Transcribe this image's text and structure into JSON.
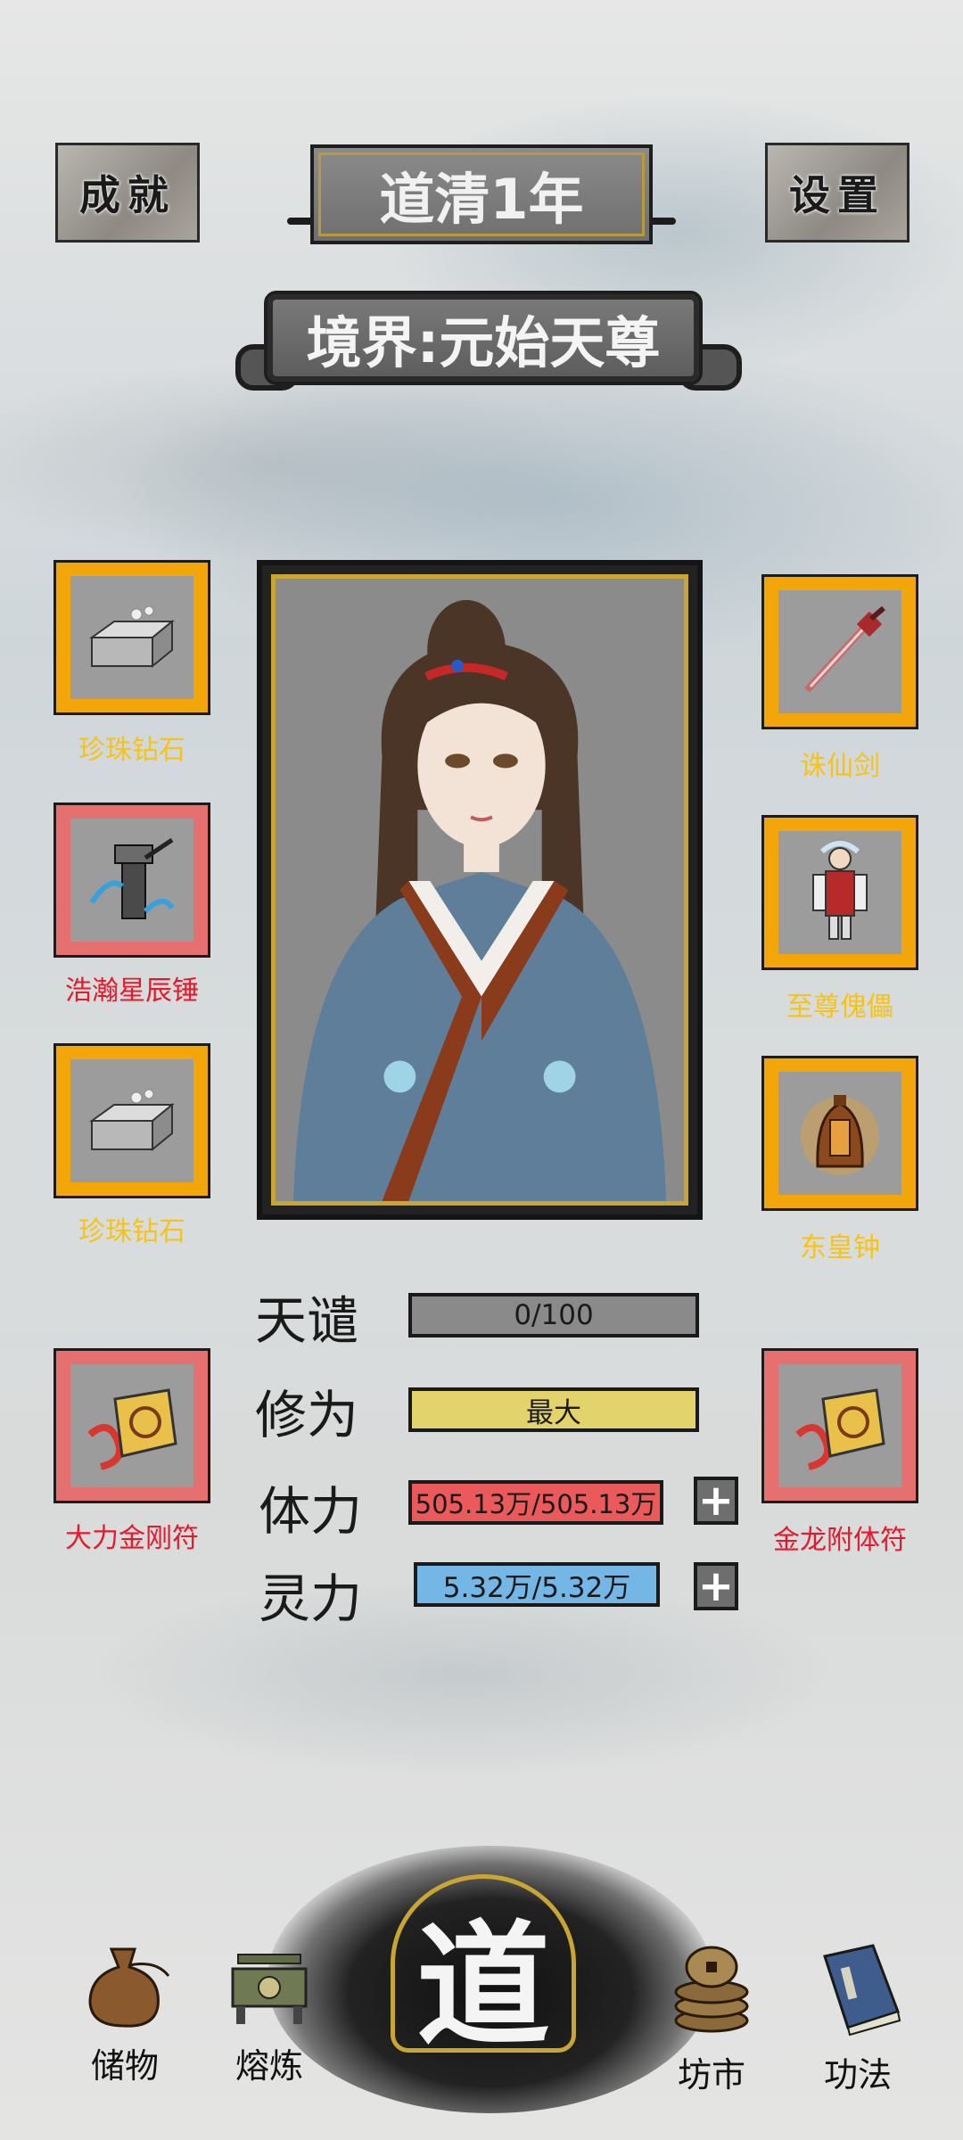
{
  "header": {
    "achievement_label": "成就",
    "year_title": "道清1年",
    "settings_label": "设置",
    "realm_title": "境界:元始天尊"
  },
  "left_slots": [
    {
      "label": "珍珠钻石",
      "rarity": "gold",
      "icon": "silver-ingot-icon"
    },
    {
      "label": "浩瀚星辰锤",
      "rarity": "red",
      "icon": "hammer-icon"
    },
    {
      "label": "珍珠钻石",
      "rarity": "gold",
      "icon": "silver-ingot-icon"
    },
    {
      "label": "大力金刚符",
      "rarity": "red",
      "icon": "talisman-icon"
    }
  ],
  "right_slots": [
    {
      "label": "诛仙剑",
      "rarity": "gold",
      "icon": "sword-icon"
    },
    {
      "label": "至尊傀儡",
      "rarity": "gold",
      "icon": "puppet-icon"
    },
    {
      "label": "东皇钟",
      "rarity": "gold",
      "icon": "bell-icon"
    },
    {
      "label": "金龙附体符",
      "rarity": "red",
      "icon": "talisman-icon"
    }
  ],
  "stats": [
    {
      "label": "天谴",
      "value": "0/100",
      "color": "#8a8a8a"
    },
    {
      "label": "修为",
      "value": "最大",
      "color": "#e3d36c"
    },
    {
      "label": "体力",
      "value": "505.13万/505.13万",
      "color": "#ea5a5a"
    },
    {
      "label": "灵力",
      "value": "5.32万/5.32万",
      "color": "#74b6e6"
    }
  ],
  "nav": {
    "storage": "储物",
    "smelt": "熔炼",
    "dao": "道",
    "market": "坊市",
    "skills": "功法"
  },
  "colors": {
    "gold_slot": "#f2a60a",
    "red_slot": "#e5706f",
    "gold_label": "#f6c318",
    "red_label": "#e8182c"
  }
}
